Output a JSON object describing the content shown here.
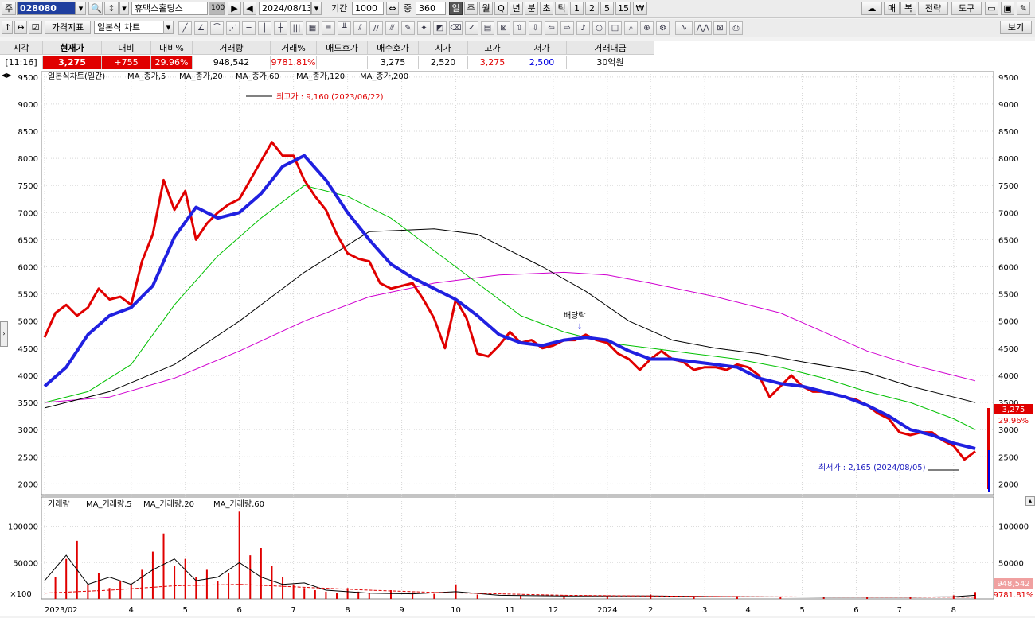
{
  "toolbar1": {
    "market_label": "주",
    "code_value": "028080",
    "search_icon": "search-icon",
    "stock_name": "휴맥스홀딩스",
    "stock_badge": "100",
    "date_value": "2024/08/13",
    "period_label": "기간",
    "period_value": "1000",
    "overlap_label": "중",
    "overlap_value": "360",
    "intervals": [
      "일",
      "주",
      "월",
      "Q",
      "년",
      "분",
      "초",
      "틱",
      "1",
      "2",
      "5",
      "15"
    ],
    "currency_button": "₩",
    "right_buttons": [
      "매",
      "복",
      "전략",
      "도구"
    ]
  },
  "toolbar2": {
    "price_indicator": "가격지표",
    "chart_type": "일본식 차트",
    "view_button": "보기"
  },
  "quote": {
    "headers": [
      "시각",
      "현재가",
      "대비",
      "대비%",
      "거래량",
      "거래%",
      "매도호가",
      "매수호가",
      "시가",
      "고가",
      "저가",
      "거래대금"
    ],
    "values": [
      "[11:16]",
      "3,275",
      "+755",
      "29.96%",
      "948,542",
      "9781.81%",
      "",
      "3,275",
      "2,520",
      "3,275",
      "2,500",
      "30억원"
    ]
  },
  "legend": {
    "price": [
      "일본식차트(일간)",
      "MA_종가,5",
      "MA_종가,20",
      "MA_종가,60",
      "MA_종가,120",
      "MA_종가,200"
    ],
    "volume": [
      "거래량",
      "MA_거래량,5",
      "MA_거래량,20",
      "MA_거래량,60"
    ]
  },
  "annotations": {
    "high": "최고가 : 9,160 (2023/06/22)",
    "low": "최저가 : 2,165 (2024/08/05)",
    "dividend": "배당락",
    "volume_unit": "×100"
  },
  "badges": {
    "price": "3,275",
    "pct": "29.96%",
    "volume": "948,542",
    "volume_pct": "9781.81%"
  },
  "colors": {
    "up": "#e00000",
    "down": "#0000e0",
    "ma5": "#e00000",
    "ma20": "#2020e0",
    "ma60": "#00c000",
    "ma120": "#000000",
    "ma200": "#d000d0"
  },
  "chart_data": {
    "type": "line",
    "title": "일본식차트(일간)",
    "ylim": [
      1800,
      9600
    ],
    "y_ticks": [
      2000,
      2500,
      3000,
      3500,
      4000,
      4500,
      5000,
      5500,
      6000,
      6500,
      7000,
      7500,
      8000,
      8500,
      9000,
      9500
    ],
    "x_tick_labels": [
      {
        "label": "2023/02",
        "x": 0
      },
      {
        "label": "4",
        "x": 8
      },
      {
        "label": "5",
        "x": 13
      },
      {
        "label": "6",
        "x": 18
      },
      {
        "label": "7",
        "x": 23
      },
      {
        "label": "8",
        "x": 28
      },
      {
        "label": "9",
        "x": 33
      },
      {
        "label": "10",
        "x": 38
      },
      {
        "label": "11",
        "x": 43
      },
      {
        "label": "12",
        "x": 47
      },
      {
        "label": "2024",
        "x": 52
      },
      {
        "label": "2",
        "x": 56
      },
      {
        "label": "3",
        "x": 61
      },
      {
        "label": "4",
        "x": 65
      },
      {
        "label": "5",
        "x": 70
      },
      {
        "label": "6",
        "x": 75
      },
      {
        "label": "7",
        "x": 79
      },
      {
        "label": "8",
        "x": 84
      }
    ],
    "x_max": 86,
    "series": [
      {
        "name": "MA_종가,5",
        "values": [
          [
            0,
            4700
          ],
          [
            1,
            5150
          ],
          [
            2,
            5300
          ],
          [
            3,
            5100
          ],
          [
            4,
            5250
          ],
          [
            5,
            5600
          ],
          [
            6,
            5400
          ],
          [
            7,
            5450
          ],
          [
            8,
            5300
          ],
          [
            9,
            6100
          ],
          [
            10,
            6600
          ],
          [
            11,
            7600
          ],
          [
            12,
            7050
          ],
          [
            13,
            7400
          ],
          [
            14,
            6500
          ],
          [
            15,
            6800
          ],
          [
            16,
            7000
          ],
          [
            17,
            7150
          ],
          [
            18,
            7250
          ],
          [
            19,
            7600
          ],
          [
            20,
            7950
          ],
          [
            21,
            8300
          ],
          [
            22,
            8050
          ],
          [
            23,
            8050
          ],
          [
            24,
            7600
          ],
          [
            25,
            7300
          ],
          [
            26,
            7050
          ],
          [
            27,
            6600
          ],
          [
            28,
            6250
          ],
          [
            29,
            6150
          ],
          [
            30,
            6100
          ],
          [
            31,
            5700
          ],
          [
            32,
            5600
          ],
          [
            33,
            5650
          ],
          [
            34,
            5700
          ],
          [
            35,
            5400
          ],
          [
            36,
            5050
          ],
          [
            37,
            4500
          ],
          [
            38,
            5400
          ],
          [
            39,
            5050
          ],
          [
            40,
            4400
          ],
          [
            41,
            4350
          ],
          [
            42,
            4550
          ],
          [
            43,
            4800
          ],
          [
            44,
            4600
          ],
          [
            45,
            4650
          ],
          [
            46,
            4500
          ],
          [
            47,
            4550
          ],
          [
            48,
            4650
          ],
          [
            49,
            4650
          ],
          [
            50,
            4750
          ],
          [
            51,
            4650
          ],
          [
            52,
            4600
          ],
          [
            53,
            4400
          ],
          [
            54,
            4300
          ],
          [
            55,
            4100
          ],
          [
            56,
            4300
          ],
          [
            57,
            4450
          ],
          [
            58,
            4300
          ],
          [
            59,
            4250
          ],
          [
            60,
            4100
          ],
          [
            61,
            4150
          ],
          [
            62,
            4150
          ],
          [
            63,
            4100
          ],
          [
            64,
            4200
          ],
          [
            65,
            4150
          ],
          [
            66,
            4000
          ],
          [
            67,
            3600
          ],
          [
            68,
            3800
          ],
          [
            69,
            4000
          ],
          [
            70,
            3800
          ],
          [
            71,
            3700
          ],
          [
            72,
            3700
          ],
          [
            73,
            3650
          ],
          [
            74,
            3600
          ],
          [
            75,
            3550
          ],
          [
            76,
            3450
          ],
          [
            77,
            3300
          ],
          [
            78,
            3200
          ],
          [
            79,
            2950
          ],
          [
            80,
            2900
          ],
          [
            81,
            2950
          ],
          [
            82,
            2950
          ],
          [
            83,
            2800
          ],
          [
            84,
            2700
          ],
          [
            85,
            2450
          ],
          [
            86,
            2600
          ]
        ]
      },
      {
        "name": "MA_종가,20",
        "values": [
          [
            0,
            3800
          ],
          [
            2,
            4150
          ],
          [
            4,
            4750
          ],
          [
            6,
            5100
          ],
          [
            8,
            5250
          ],
          [
            10,
            5650
          ],
          [
            12,
            6550
          ],
          [
            14,
            7100
          ],
          [
            16,
            6900
          ],
          [
            18,
            7000
          ],
          [
            20,
            7350
          ],
          [
            22,
            7850
          ],
          [
            24,
            8050
          ],
          [
            26,
            7600
          ],
          [
            28,
            7000
          ],
          [
            30,
            6500
          ],
          [
            32,
            6050
          ],
          [
            34,
            5800
          ],
          [
            36,
            5600
          ],
          [
            38,
            5400
          ],
          [
            40,
            5100
          ],
          [
            42,
            4750
          ],
          [
            44,
            4600
          ],
          [
            46,
            4550
          ],
          [
            48,
            4650
          ],
          [
            50,
            4700
          ],
          [
            52,
            4650
          ],
          [
            54,
            4450
          ],
          [
            56,
            4300
          ],
          [
            58,
            4300
          ],
          [
            60,
            4250
          ],
          [
            62,
            4200
          ],
          [
            64,
            4150
          ],
          [
            66,
            3950
          ],
          [
            68,
            3850
          ],
          [
            70,
            3800
          ],
          [
            72,
            3700
          ],
          [
            74,
            3600
          ],
          [
            76,
            3450
          ],
          [
            78,
            3250
          ],
          [
            80,
            3000
          ],
          [
            82,
            2900
          ],
          [
            84,
            2750
          ],
          [
            86,
            2650
          ]
        ]
      },
      {
        "name": "MA_종가,60",
        "values": [
          [
            0,
            3500
          ],
          [
            4,
            3700
          ],
          [
            8,
            4200
          ],
          [
            12,
            5300
          ],
          [
            16,
            6200
          ],
          [
            20,
            6900
          ],
          [
            24,
            7500
          ],
          [
            28,
            7300
          ],
          [
            32,
            6900
          ],
          [
            36,
            6300
          ],
          [
            40,
            5700
          ],
          [
            44,
            5100
          ],
          [
            48,
            4800
          ],
          [
            52,
            4600
          ],
          [
            56,
            4500
          ],
          [
            60,
            4400
          ],
          [
            64,
            4300
          ],
          [
            68,
            4150
          ],
          [
            72,
            3950
          ],
          [
            76,
            3700
          ],
          [
            80,
            3500
          ],
          [
            84,
            3200
          ],
          [
            86,
            3000
          ]
        ]
      },
      {
        "name": "MA_종가,120",
        "values": [
          [
            0,
            3400
          ],
          [
            6,
            3700
          ],
          [
            12,
            4200
          ],
          [
            18,
            5000
          ],
          [
            24,
            5900
          ],
          [
            30,
            6650
          ],
          [
            36,
            6700
          ],
          [
            40,
            6600
          ],
          [
            46,
            6000
          ],
          [
            50,
            5550
          ],
          [
            54,
            5000
          ],
          [
            58,
            4650
          ],
          [
            62,
            4500
          ],
          [
            66,
            4400
          ],
          [
            70,
            4250
          ],
          [
            76,
            4050
          ],
          [
            80,
            3800
          ],
          [
            84,
            3600
          ],
          [
            86,
            3500
          ]
        ]
      },
      {
        "name": "MA_종가,200",
        "values": [
          [
            0,
            3500
          ],
          [
            6,
            3600
          ],
          [
            12,
            3950
          ],
          [
            18,
            4450
          ],
          [
            24,
            5000
          ],
          [
            30,
            5450
          ],
          [
            36,
            5700
          ],
          [
            42,
            5850
          ],
          [
            48,
            5900
          ],
          [
            52,
            5850
          ],
          [
            56,
            5700
          ],
          [
            62,
            5450
          ],
          [
            68,
            5150
          ],
          [
            72,
            4800
          ],
          [
            76,
            4450
          ],
          [
            80,
            4200
          ],
          [
            84,
            4000
          ],
          [
            86,
            3900
          ]
        ]
      }
    ],
    "volume": {
      "ylim": [
        0,
        140000
      ],
      "y_ticks": [
        50000,
        100000
      ],
      "bars": [
        [
          1,
          30000
        ],
        [
          2,
          55000
        ],
        [
          3,
          80000
        ],
        [
          4,
          20000
        ],
        [
          5,
          35000
        ],
        [
          6,
          15000
        ],
        [
          7,
          25000
        ],
        [
          8,
          20000
        ],
        [
          9,
          40000
        ],
        [
          10,
          65000
        ],
        [
          11,
          90000
        ],
        [
          12,
          45000
        ],
        [
          13,
          55000
        ],
        [
          14,
          30000
        ],
        [
          15,
          40000
        ],
        [
          16,
          25000
        ],
        [
          17,
          35000
        ],
        [
          18,
          120000
        ],
        [
          19,
          60000
        ],
        [
          20,
          70000
        ],
        [
          21,
          45000
        ],
        [
          22,
          30000
        ],
        [
          23,
          20000
        ],
        [
          24,
          15000
        ],
        [
          25,
          12000
        ],
        [
          26,
          10000
        ],
        [
          27,
          8000
        ],
        [
          28,
          15000
        ],
        [
          29,
          10000
        ],
        [
          30,
          8000
        ],
        [
          32,
          12000
        ],
        [
          34,
          9000
        ],
        [
          36,
          7000
        ],
        [
          38,
          20000
        ],
        [
          40,
          6000
        ],
        [
          44,
          5000
        ],
        [
          48,
          5000
        ],
        [
          52,
          4000
        ],
        [
          56,
          6000
        ],
        [
          60,
          4000
        ],
        [
          64,
          4000
        ],
        [
          68,
          3000
        ],
        [
          72,
          3000
        ],
        [
          76,
          3000
        ],
        [
          80,
          3000
        ],
        [
          84,
          5000
        ],
        [
          86,
          9500
        ]
      ],
      "ma5": [
        [
          0,
          25000
        ],
        [
          2,
          60000
        ],
        [
          4,
          20000
        ],
        [
          6,
          30000
        ],
        [
          8,
          20000
        ],
        [
          10,
          40000
        ],
        [
          12,
          55000
        ],
        [
          14,
          25000
        ],
        [
          16,
          30000
        ],
        [
          18,
          50000
        ],
        [
          20,
          30000
        ],
        [
          22,
          20000
        ],
        [
          24,
          22000
        ],
        [
          26,
          12000
        ],
        [
          28,
          10000
        ],
        [
          30,
          8000
        ],
        [
          34,
          7000
        ],
        [
          38,
          10000
        ],
        [
          42,
          5000
        ],
        [
          48,
          4000
        ],
        [
          56,
          4000
        ],
        [
          64,
          3000
        ],
        [
          72,
          2500
        ],
        [
          80,
          2500
        ],
        [
          84,
          3000
        ],
        [
          86,
          5000
        ]
      ],
      "ma20": [
        [
          0,
          8000
        ],
        [
          6,
          12000
        ],
        [
          12,
          18000
        ],
        [
          18,
          20000
        ],
        [
          24,
          16000
        ],
        [
          30,
          12000
        ],
        [
          36,
          9000
        ],
        [
          42,
          7000
        ],
        [
          48,
          5000
        ],
        [
          56,
          4000
        ],
        [
          66,
          3000
        ],
        [
          76,
          2500
        ],
        [
          86,
          2500
        ]
      ]
    }
  }
}
